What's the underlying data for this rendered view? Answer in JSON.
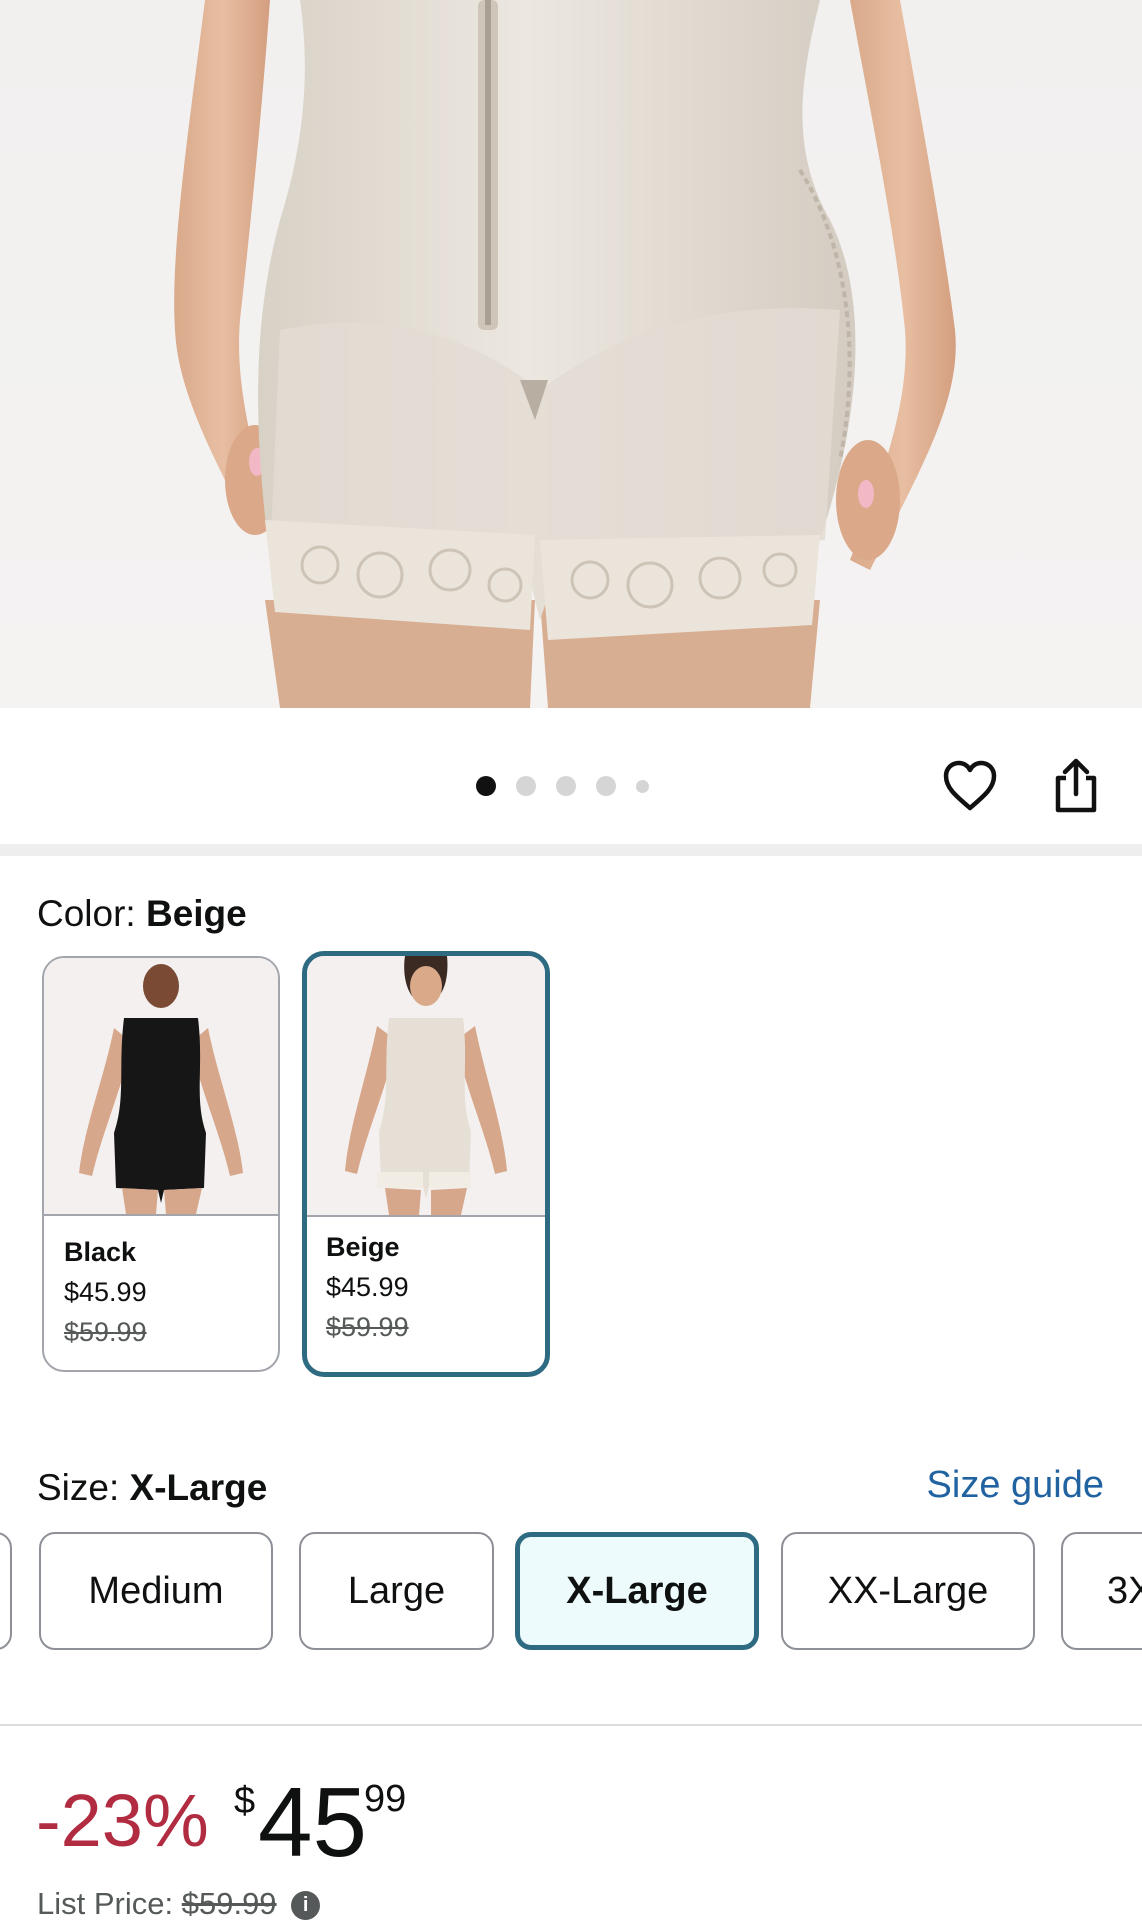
{
  "hero": {
    "image_name": "product-photo-beige-shapewear"
  },
  "carousel": {
    "dot_count": 5,
    "active_index": 0
  },
  "actions": {
    "favorite_icon": "heart-icon",
    "share_icon": "share-icon"
  },
  "color": {
    "label": "Color:",
    "selected": "Beige",
    "swatches": [
      {
        "name": "Black",
        "price": "$45.99",
        "list_price": "$59.99",
        "selected": false,
        "garment_color": "#161616"
      },
      {
        "name": "Beige",
        "price": "$45.99",
        "list_price": "$59.99",
        "selected": true,
        "garment_color": "#e4ddd3"
      }
    ]
  },
  "size": {
    "label": "Size:",
    "selected": "X-Large",
    "guide_link": "Size guide",
    "options": [
      "Medium",
      "Large",
      "X-Large",
      "XX-Large",
      "3X"
    ]
  },
  "price": {
    "discount": "-23%",
    "currency": "$",
    "whole": "45",
    "fraction": "99",
    "list_price_label": "List Price:",
    "list_price_value": "$59.99",
    "info_icon": "i"
  },
  "colors": {
    "accent_selected": "#2e6b82",
    "discount_red": "#b12b41",
    "link_blue": "#2162a1"
  }
}
